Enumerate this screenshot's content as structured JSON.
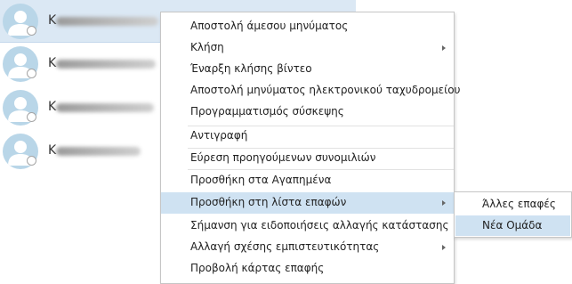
{
  "contacts": [
    {
      "initial": "K",
      "presence": "offline",
      "selected": true
    },
    {
      "initial": "K",
      "presence": "offline",
      "selected": false
    },
    {
      "initial": "K",
      "presence": "offline",
      "selected": false
    },
    {
      "initial": "K",
      "presence": "offline",
      "selected": false
    }
  ],
  "context_menu": {
    "items": [
      {
        "label": "Αποστολή άμεσου μηνύματος"
      },
      {
        "label": "Κλήση",
        "has_submenu": true
      },
      {
        "label": "Έναρξη κλήσης βίντεο"
      },
      {
        "label": "Αποστολή μηνύματος ηλεκτρονικού ταχυδρομείου"
      },
      {
        "label": "Προγραμματισμός σύσκεψης"
      },
      {
        "label": "Αντιγραφή"
      },
      {
        "label": "Εύρεση προηγούμενων συνομιλιών"
      },
      {
        "label": "Προσθήκη στα Αγαπημένα"
      },
      {
        "label": "Προσθήκη στη λίστα επαφών",
        "has_submenu": true,
        "highlighted": true
      },
      {
        "label": "Σήμανση για ειδοποιήσεις αλλαγής κατάστασης"
      },
      {
        "label": "Αλλαγή σχέσης εμπιστευτικότητας",
        "has_submenu": true
      },
      {
        "label": "Προβολή κάρτας επαφής"
      }
    ]
  },
  "submenu": {
    "items": [
      {
        "label": "Άλλες επαφές"
      },
      {
        "label": "Νέα Ομάδα",
        "highlighted": true
      }
    ]
  },
  "colors": {
    "selected_row": "#dbe8f4",
    "highlight": "#cfe2f2",
    "avatar": "#b9d6e8"
  }
}
